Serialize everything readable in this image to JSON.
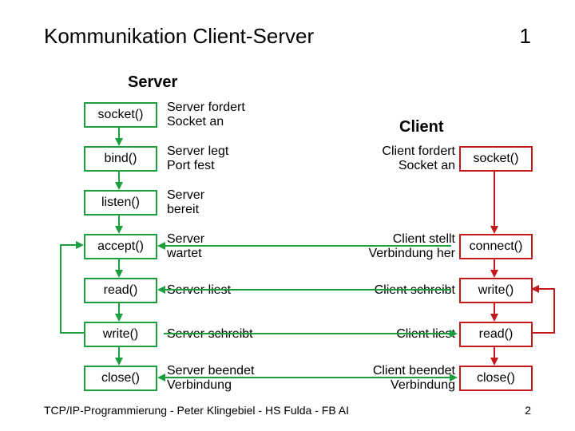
{
  "title": "Kommunikation Client-Server",
  "page_top": "1",
  "page_bottom": "2",
  "footer": "TCP/IP-Programmierung - Peter Klingebiel - HS Fulda - FB AI",
  "server_header": "Server",
  "client_header": "Client",
  "server": {
    "socket": {
      "fn": "socket()",
      "desc": "Server fordert\nSocket an"
    },
    "bind": {
      "fn": "bind()",
      "desc": "Server legt\nPort fest"
    },
    "listen": {
      "fn": "listen()",
      "desc": "Server\nbereit"
    },
    "accept": {
      "fn": "accept()",
      "desc": "Server\nwartet"
    },
    "read": {
      "fn": "read()",
      "desc": "Server liest"
    },
    "write": {
      "fn": "write()",
      "desc": "Server schreibt"
    },
    "close": {
      "fn": "close()",
      "desc": "Server beendet\nVerbindung"
    }
  },
  "client": {
    "socket": {
      "fn": "socket()",
      "desc": "Client fordert\nSocket an"
    },
    "connect": {
      "fn": "connect()",
      "desc": "Client stellt\nVerbindung her"
    },
    "write": {
      "fn": "write()",
      "desc": "Client schreibt"
    },
    "read": {
      "fn": "read()",
      "desc": "Client liest"
    },
    "close": {
      "fn": "close()",
      "desc": "Client beendet\nVerbindung"
    }
  }
}
